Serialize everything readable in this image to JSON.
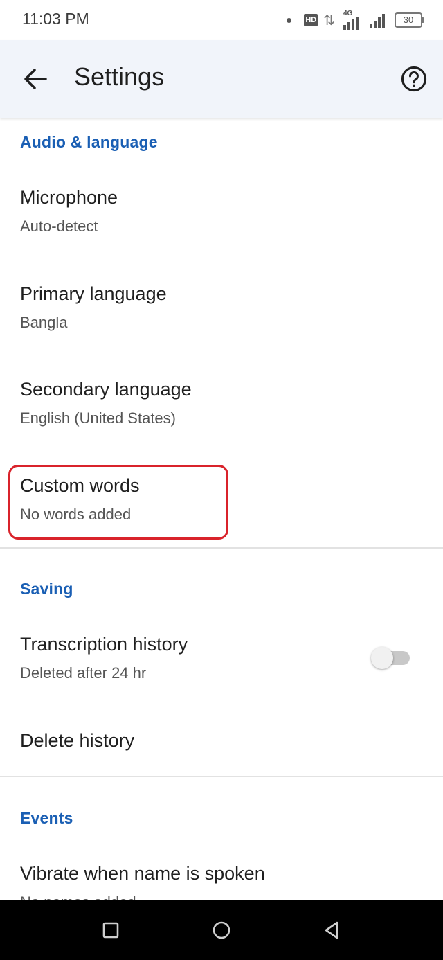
{
  "status_bar": {
    "time": "11:03 PM",
    "hd_label": "HD",
    "network_label": "4G",
    "battery": "30"
  },
  "app_bar": {
    "title": "Settings",
    "back_icon": "arrow-left-icon",
    "help_icon": "help-circle-icon"
  },
  "sections": {
    "audio": {
      "header": "Audio & language",
      "items": [
        {
          "title": "Microphone",
          "subtitle": "Auto-detect"
        },
        {
          "title": "Primary language",
          "subtitle": "Bangla"
        },
        {
          "title": "Secondary language",
          "subtitle": "English (United States)"
        },
        {
          "title": "Custom words",
          "subtitle": "No words added"
        }
      ]
    },
    "saving": {
      "header": "Saving",
      "items": [
        {
          "title": "Transcription history",
          "subtitle": "Deleted after 24 hr",
          "toggle_on": false
        },
        {
          "title": "Delete history"
        }
      ]
    },
    "events": {
      "header": "Events",
      "items": [
        {
          "title": "Vibrate when name is spoken",
          "subtitle": "No names added"
        }
      ]
    }
  },
  "highlight_color": "#d9232b",
  "accent_color": "#1a5fb4",
  "nav_bar": {
    "recents_icon": "square-icon",
    "home_icon": "circle-icon",
    "back_icon": "triangle-back-icon"
  }
}
